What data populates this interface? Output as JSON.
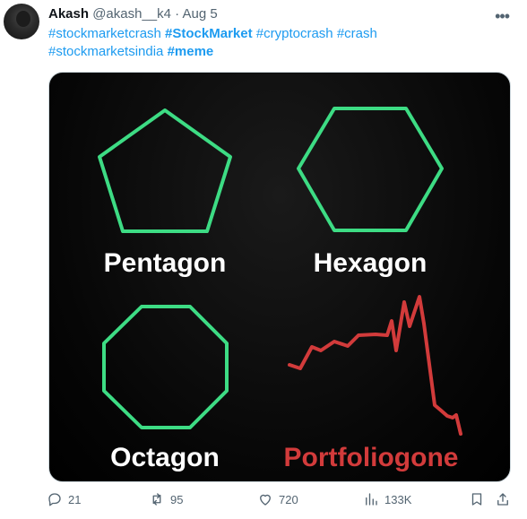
{
  "author": {
    "name": "Akash",
    "handle": "@akash__k4",
    "separator": "·",
    "date": "Aug 5"
  },
  "tweet": {
    "hashtags": [
      {
        "text": "#stockmarketcrash",
        "bold": false
      },
      {
        "text": "#StockMarket",
        "bold": true
      },
      {
        "text": "#cryptocrash",
        "bold": false
      },
      {
        "text": "#crash",
        "bold": false
      },
      {
        "text": "#stockmarketsindia",
        "bold": false
      },
      {
        "text": "#meme",
        "bold": true
      }
    ]
  },
  "meme": {
    "labels": {
      "pentagon": "Pentagon",
      "hexagon": "Hexagon",
      "octagon": "Octagon",
      "portfolio": "Portfoliogone"
    },
    "colors": {
      "shape_stroke": "#3ddc84",
      "line_stroke": "#d23b3b",
      "label_white": "#ffffff",
      "label_red": "#d23b3b",
      "background": "#000000"
    }
  },
  "actions": {
    "replies": "21",
    "retweets": "95",
    "likes": "720",
    "views": "133K"
  },
  "icons": [
    "more-icon",
    "reply-icon",
    "retweet-icon",
    "like-icon",
    "views-icon",
    "bookmark-icon",
    "share-icon"
  ]
}
